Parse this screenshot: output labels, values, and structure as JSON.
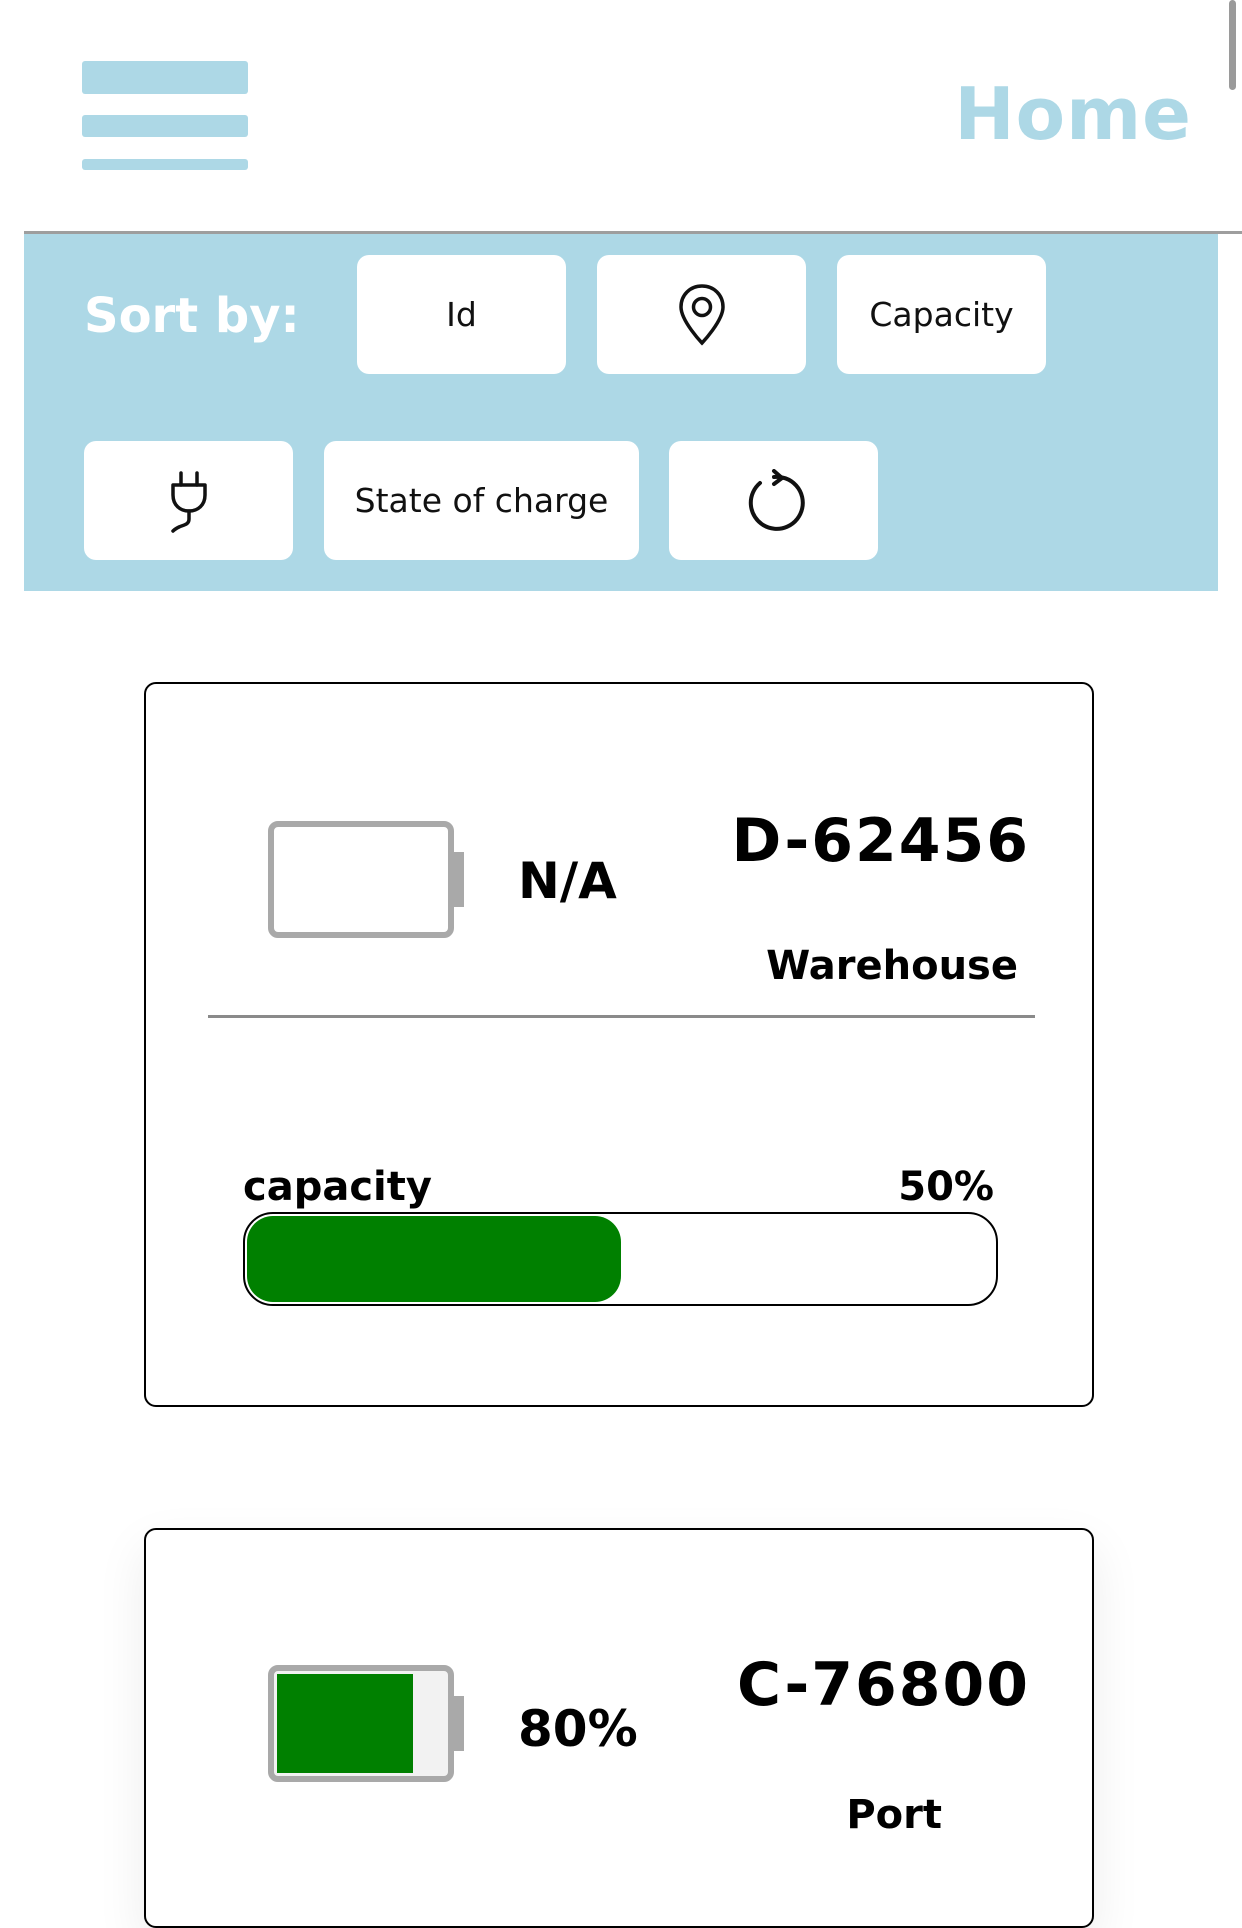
{
  "header": {
    "title": "Home"
  },
  "sort": {
    "label": "Sort by:",
    "buttons": {
      "id": "Id",
      "location_icon": "map-pin-icon",
      "capacity": "Capacity",
      "plug_icon": "plug-icon",
      "state_of_charge": "State of charge",
      "reset_icon": "reset-icon"
    }
  },
  "colors": {
    "accent": "#add8e6",
    "fill_green": "#008000",
    "battery_outline": "#a9a9a9"
  },
  "devices": [
    {
      "id": "D-62456",
      "location": "Warehouse",
      "charge_text": "N/A",
      "charge_fraction": 0,
      "capacity_label": "capacity",
      "capacity_value": "50%",
      "capacity_fraction": 0.5
    },
    {
      "id": "C-76800",
      "location": "Port",
      "charge_text": "80%",
      "charge_fraction": 0.8
    }
  ]
}
